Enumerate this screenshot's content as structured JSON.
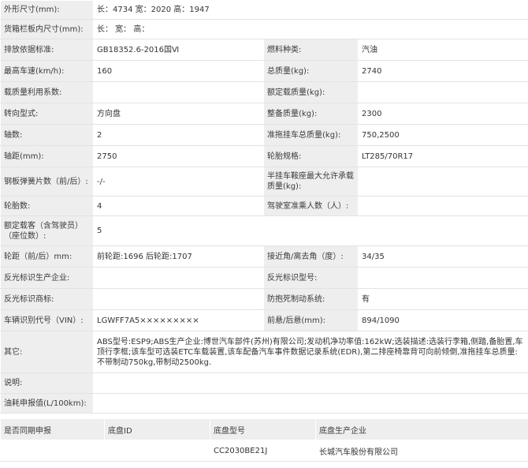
{
  "rows": [
    {
      "l1": "外形尺寸(mm):",
      "v1": "长：4734 宽：2020 高：1947",
      "span": true
    },
    {
      "l1": "货箱栏板内尺寸(mm):",
      "v1": "长： 宽： 高：",
      "span": true
    },
    {
      "l1": "排放依据标准:",
      "v1": "GB18352.6-2016国Ⅵ",
      "l2": "燃料种类:",
      "v2": "汽油"
    },
    {
      "l1": "最高车速(km/h):",
      "v1": "160",
      "l2": "总质量(kg):",
      "v2": "2740"
    },
    {
      "l1": "载质量利用系数:",
      "v1": "",
      "l2": "额定载质量(kg):",
      "v2": ""
    },
    {
      "l1": "转向型式:",
      "v1": "方向盘",
      "l2": "整备质量(kg):",
      "v2": "2300"
    },
    {
      "l1": "轴数:",
      "v1": "2",
      "l2": "准拖挂车总质量(kg):",
      "v2": "750,2500"
    },
    {
      "l1": "轴距(mm):",
      "v1": "2750",
      "l2": "轮胎规格:",
      "v2": "LT285/70R17"
    },
    {
      "l1": "钢板弹簧片数（前/后）:",
      "v1": "-/-",
      "l2": "半挂车鞍座最大允许承载质量(kg):",
      "v2": ""
    },
    {
      "l1": "轮胎数:",
      "v1": "4",
      "l2": "驾驶室准乘人数（人）:",
      "v2": ""
    },
    {
      "l1": "额定载客（含驾驶员）（座位数）:",
      "v1": "5",
      "span": true
    },
    {
      "l1": "轮距（前/后）mm:",
      "v1": "前轮距:1696 后轮距:1707",
      "l2": "接近角/离去角（度）:",
      "v2": "34/35"
    },
    {
      "l1": "反光标识生产企业:",
      "v1": "",
      "l2": "反光标识型号:",
      "v2": ""
    },
    {
      "l1": "反光标识商标:",
      "v1": "",
      "l2": "防抱死制动系统:",
      "v2": "有"
    },
    {
      "l1": "车辆识别代号（VIN）:",
      "v1": "LGWFF7A5×××××××××",
      "l2": "前悬/后悬(mm):",
      "v2": "894/1090"
    },
    {
      "l1": "其它:",
      "v1": "ABS型号:ESP9;ABS生产企业:博世汽车部件(苏州)有限公司;发动机净功率值:162kW;选装描述:选装行李箱,侧踏,备胎置,车顶行李框;该车型可选装ETC车载装置,该车配备汽车事件数据记录系统(EDR),第二排座椅靠背可向前倾倒,准拖挂车总质量:不带制动750kg,带制动2500kg.",
      "span": true
    },
    {
      "l1": "说明:",
      "v1": "",
      "span": true
    },
    {
      "l1": "油耗申报值(L/100km):",
      "v1": "",
      "span": true
    }
  ],
  "bottom": {
    "headers": [
      "是否同期申报",
      "底盘ID",
      "底盘型号",
      "底盘生产企业"
    ],
    "row": [
      "",
      "",
      "CC2030BE21J",
      "长城汽车股份有限公司"
    ]
  }
}
